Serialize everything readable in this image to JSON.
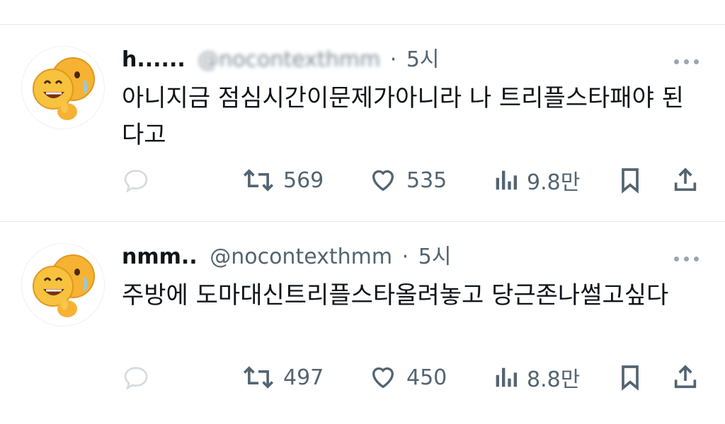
{
  "tweets": [
    {
      "name": "h......",
      "handle": "@nocontexthmm",
      "separator": "·",
      "time": "5시",
      "text": "아니지금 점심시간이문제가아니라 나 트리플스타패야 된다고",
      "actions": {
        "reply_icon": "reply-icon",
        "retweets": "569",
        "likes": "535",
        "views": "9.8만",
        "bookmark_icon": "bookmark-icon",
        "share_icon": "share-icon"
      }
    },
    {
      "name": "nmm..",
      "handle": "@nocontexthmm",
      "separator": "·",
      "time": "5시",
      "text": "주방에 도마대신트리플스타올려놓고 당근존나썰고싶다",
      "actions": {
        "reply_icon": "reply-icon",
        "retweets": "497",
        "likes": "450",
        "views": "8.8만",
        "bookmark_icon": "bookmark-icon",
        "share_icon": "share-icon"
      }
    }
  ],
  "colors": {
    "text": "#0f1419",
    "secondary": "#536471",
    "icon": "#536471",
    "divider": "#e6e8ea",
    "emoji": "#f7b731"
  }
}
